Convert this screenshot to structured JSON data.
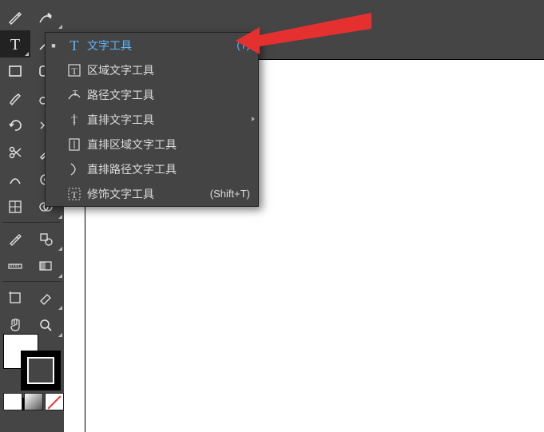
{
  "toolbar": {
    "rows": [
      [
        "pen-icon",
        "curvature-pen-icon"
      ],
      [
        "type-icon",
        "line-segment-icon"
      ],
      [
        "rectangle-icon",
        "rounded-rect-icon"
      ],
      [
        "paintbrush-icon",
        "blob-brush-icon"
      ],
      [
        "rotate-icon",
        "reflect-icon"
      ],
      [
        "scissors-icon",
        "knife-icon"
      ],
      [
        "warp-icon",
        "width-icon"
      ],
      [
        "mesh-icon",
        "shapebuilder-icon"
      ],
      [
        "eyedropper-icon",
        "liveshape-icon"
      ],
      [
        "measure-icon",
        "gradient-icon"
      ],
      [
        "artboard-icon",
        "eraser-icon"
      ],
      [
        "hand-icon",
        "zoom-icon"
      ]
    ]
  },
  "flyout": {
    "items": [
      {
        "label": "文字工具",
        "shortcut": "(T)",
        "active": true,
        "icon": "type-T",
        "dot": true
      },
      {
        "label": "区域文字工具",
        "shortcut": "",
        "icon": "area-type"
      },
      {
        "label": "路径文字工具",
        "shortcut": "",
        "icon": "path-type"
      },
      {
        "label": "直排文字工具",
        "shortcut": "",
        "icon": "vert-type",
        "submenu": true
      },
      {
        "label": "直排区域文字工具",
        "shortcut": "",
        "icon": "vert-area-type"
      },
      {
        "label": "直排路径文字工具",
        "shortcut": "",
        "icon": "vert-path-type"
      },
      {
        "label": "修饰文字工具",
        "shortcut": "(Shift+T)",
        "icon": "touch-type"
      }
    ]
  },
  "swatches": {
    "fill": "#ffffff",
    "stroke": "#000000"
  },
  "colormodes": [
    "solid",
    "gradient",
    "none"
  ]
}
